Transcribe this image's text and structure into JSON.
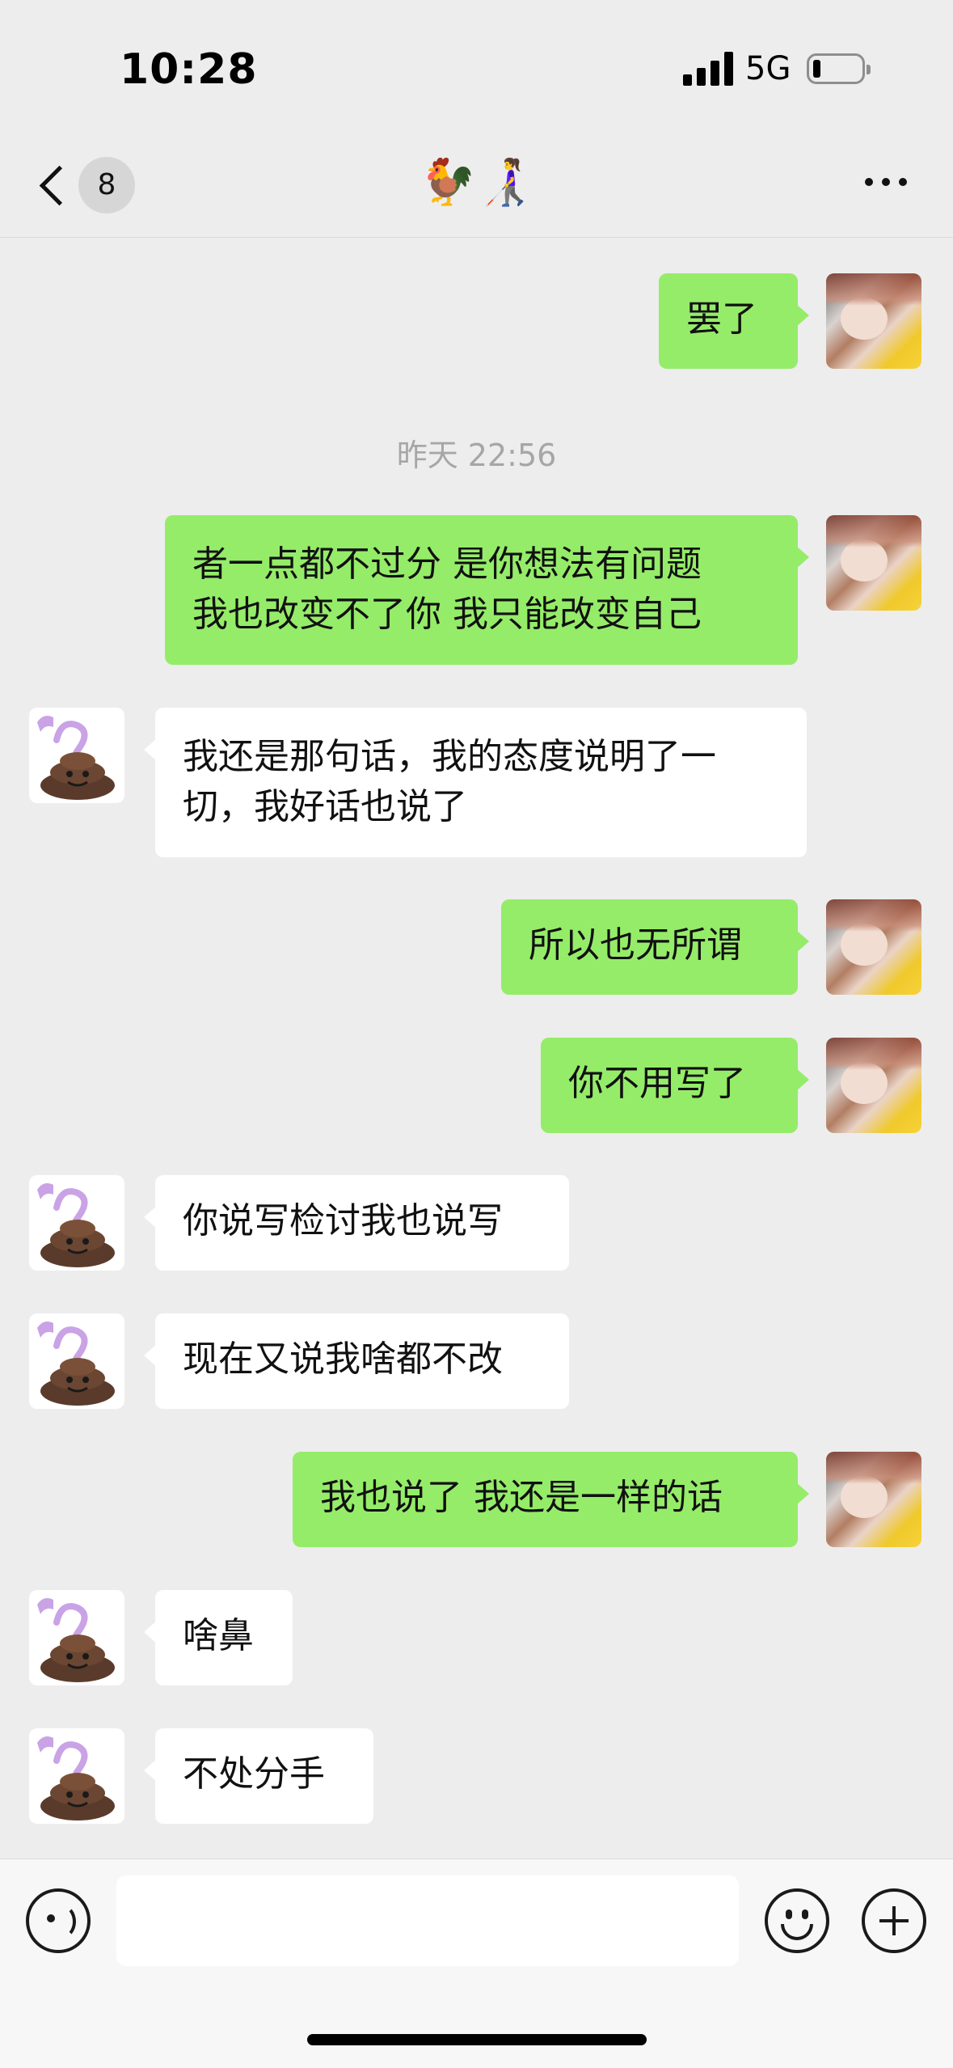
{
  "status_bar": {
    "time": "10:28",
    "network": "5G",
    "battery_level": 0.1
  },
  "nav": {
    "unread_count": "8",
    "title": "🐓👩‍🦯",
    "more_icon": "more-dots-icon"
  },
  "timestamp": "昨天 22:56",
  "messages": [
    {
      "sender": "me",
      "text": "罢了"
    },
    {
      "sender": "me",
      "text": "者一点都不过分 是你想法有问题\n我也改变不了你 我只能改变自己"
    },
    {
      "sender": "other",
      "text": "我还是那句话，我的态度说明了一\n切，我好话也说了"
    },
    {
      "sender": "me",
      "text": "所以也无所谓"
    },
    {
      "sender": "me",
      "text": "你不用写了"
    },
    {
      "sender": "other",
      "text": "你说写检讨我也说写"
    },
    {
      "sender": "other",
      "text": "现在又说我啥都不改"
    },
    {
      "sender": "me",
      "text": "我也说了 我还是一样的话"
    },
    {
      "sender": "other",
      "text": "啥鼻"
    },
    {
      "sender": "other",
      "text": "不处分手"
    }
  ],
  "input_bar": {
    "text_value": "",
    "left_icon": "voice-icon",
    "right_icons": [
      "emoji-icon",
      "plus-icon"
    ]
  },
  "colors": {
    "background": "#ededed",
    "my_bubble": "#95ec69",
    "other_bubble": "#ffffff",
    "timestamp": "#a6a6a6"
  }
}
